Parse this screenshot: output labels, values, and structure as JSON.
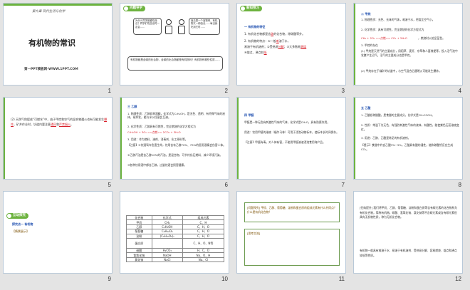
{
  "slides": [
    {
      "num": "1",
      "kicker": "第九章 现代生活与化学",
      "title": "有机物的常识",
      "footer": "第一PPT模板网-WWW.1PPT.COM"
    },
    {
      "num": "2",
      "badge": "问题导学",
      "bubble_left": "为什么同学都爱吃西瓜？同学们吃西瓜时一定会……",
      "bubble_right": "西瓜是一个宝物呀，有机物又一种西瓜……每当我吃到它时……",
      "bottom_note": "有机物都是含碳的化合物，含碳的化合物都是有机物吗？有机物有哪些性质……"
    },
    {
      "num": "3",
      "badge": "新知预习",
      "heading": "一 有机物的特征",
      "lines": [
        "1. 有机化合物都是含",
        "2. 有机物的特点：①一般",
        "溶于水，",
        "易溶于有机溶剂；②受热易",
        "；③大多数易",
        "④熔点、沸点较"
      ],
      "answers": [
        "碳",
        "难",
        "分解",
        "燃烧",
        "低"
      ],
      "tail": "的化合物，除碳酸等外。"
    },
    {
      "num": "4",
      "heading": "二 甲烷",
      "lines": [
        "1. 物理性质：无色、无味的气体，难溶于水，密度比空气小。",
        "2. 化学性质：具有可燃性。完全燃烧的化学方程式为",
        "CH₄ + 2O₂ ==点燃== CO₂ + 2H₂O",
        "，燃烧时火焰呈蓝色。",
        "3. 甲烷的存在",
        "(1) 甲烷是天然气的主要成分，用稻草、麦秆、杂草和人畜粪便等，投入沼气池中发酵产生沼气，沼气的主要成分也是甲烷。",
        "(2) 甲烷存在于煤矿的坑道中，与空气混合后遇明火可能发生爆炸。"
      ]
    },
    {
      "num": "5",
      "lines": [
        "(2) 天然气和煤成“可燃冰”中，由于甲烷和空气的混合物遇火也有可能发生",
        "爆炸",
        "，矿井作业时，坑道内要注意",
        "通风",
        "和",
        "严禁烟火",
        "。"
      ]
    },
    {
      "num": "6",
      "heading": "三  乙醇",
      "lines": [
        "1. 物理性质：乙醇俗称酒精，化学式为C₂H₅OH，是无色、透明、有特殊气味的液体，易挥发，能与水以任意比互溶。",
        "2. 化学性质：乙醇具有可燃性，完全燃烧的化学方程式为",
        "C₂H₅OH + 3O₂ ==点燃== 2CO₂ + 3H₂O",
        "3. 用途：作为燃料、溶剂、消毒剂、化工原料等。",
        "【注意】①饮酒驾车危害生命，饮用含有乙醇70%、75%的医用酒精会伤害人体。",
        "②乙醇汽油是含乙醇10%的汽油，是混合物，可节约化石燃料、减少环境污染。",
        "③各种饮用酒中都含乙醇，过量饮酒会损害健康。"
      ]
    },
    {
      "num": "7",
      "heading": "四  甲醛",
      "lines": [
        "甲醛是一种无色有刺激性气味的气体，化学式是CH₂O，具有防腐作用。",
        "用途：饮用甲醛的溶液（福尔马林）可用于浸泡动物标本，使标本长时间保存。",
        "【注意】甲醛有毒，对人体有害，不能用甲醛溶液浸泡食用海产品。"
      ]
    },
    {
      "num": "8",
      "heading": "五  乙酸",
      "lines": [
        "1. 乙酸俗称醋酸，是食醋的主要成分，化学式是CH₃COOH。",
        "2. 性质：常温下为无色、有强烈刺激性气味的液体，有酸性，能使紫色石蕊溶液变红。",
        "3. 用途：乙醇、乙酸是常见的有机溶剂。",
        "【提示】食醋中约含乙酸3%~5%，乙酸具有酸的通性，能和碳酸钙反应生成CO₂。"
      ]
    },
    {
      "num": "9",
      "badge": "互动探究",
      "heading": "探究点一  有机物",
      "label": "【情景展示】"
    },
    {
      "num": "10",
      "table_header": [
        "化合物",
        "化学式",
        "组成元素"
      ],
      "table_rows": [
        [
          "甲烷",
          "CH₄",
          "C、H"
        ],
        [
          "乙醇",
          "C₂H₅OH",
          "C、H、O"
        ],
        [
          "葡萄糖",
          "C₆H₁₂O₆",
          "C、H、O"
        ],
        [
          "淀粉",
          "(C₆H₁₀O₅)ₙ",
          "C、H、O"
        ],
        [
          "蛋白质",
          "",
          "C、H、O、N等"
        ],
        [
          "碳酸",
          "H₂CO₃",
          "H、C、O"
        ],
        [
          "氢氧化钠",
          "NaOH",
          "Na、O、H"
        ],
        [
          "氯化钠",
          "NaCl",
          "Na、Cl"
        ]
      ]
    },
    {
      "num": "11",
      "question": "[问题探究] 甲烷、乙醇、葡萄糖、淀粉和蛋白质的组成元素有什么共同点？什么是有机化合物？",
      "answer_label": "[思考交流]"
    },
    {
      "num": "12",
      "lines": [
        "[归纳提升] 我们将甲烷、乙醇、葡萄糖、淀粉和蛋白质等含有碳元素的化合物称为有机化合物，简称有机物。碳酸、氢氧化钠、氯化钠等不含碳元素或含有碳元素但具有无机物性质，称为无机化合物。",
        "有机物一般具有难溶于水、易溶于有机溶剂、受热易分解、容易燃烧、熔点和沸点较低等性质。"
      ]
    }
  ]
}
